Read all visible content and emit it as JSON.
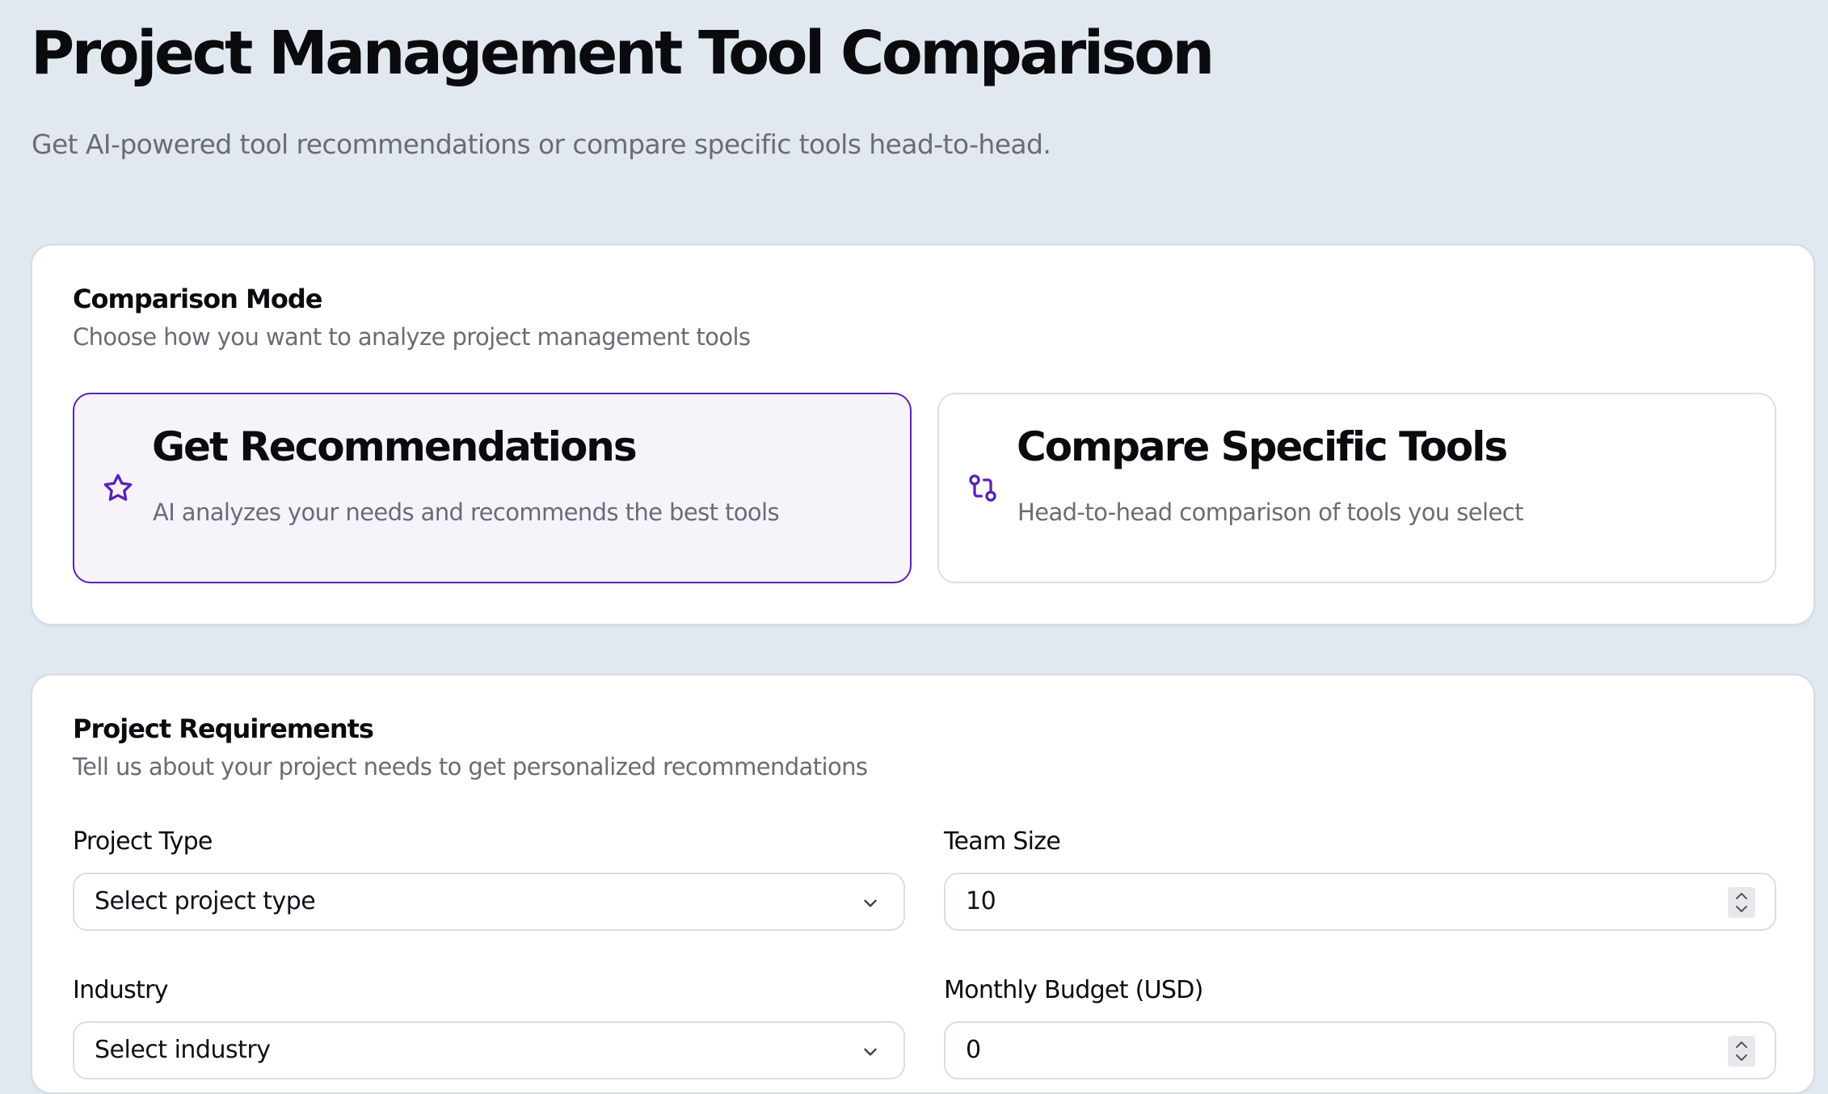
{
  "header": {
    "title": "Project Management Tool Comparison",
    "subtitle": "Get AI-powered tool recommendations or compare specific tools head-to-head."
  },
  "comparison_mode": {
    "title": "Comparison Mode",
    "description": "Choose how you want to analyze project management tools",
    "selected": "recommendations",
    "options": [
      {
        "id": "recommendations",
        "icon": "star-icon",
        "title": "Get Recommendations",
        "description": "AI analyzes your needs and recommends the best tools"
      },
      {
        "id": "compare",
        "icon": "git-compare-icon",
        "title": "Compare Specific Tools",
        "description": "Head-to-head comparison of tools you select"
      }
    ]
  },
  "requirements": {
    "title": "Project Requirements",
    "description": "Tell us about your project needs to get personalized recommendations",
    "fields": {
      "project_type": {
        "label": "Project Type",
        "value": "Select project type"
      },
      "team_size": {
        "label": "Team Size",
        "value": "10"
      },
      "industry": {
        "label": "Industry",
        "value": "Select industry"
      },
      "monthly_budget": {
        "label": "Monthly Budget (USD)",
        "value": "0"
      }
    }
  },
  "colors": {
    "background": "#e2e8f0",
    "accent": "#5b21b6",
    "selected_option_bg": "#f6f3fb",
    "muted_text": "#6b6b78",
    "card_bg": "#ffffff"
  }
}
